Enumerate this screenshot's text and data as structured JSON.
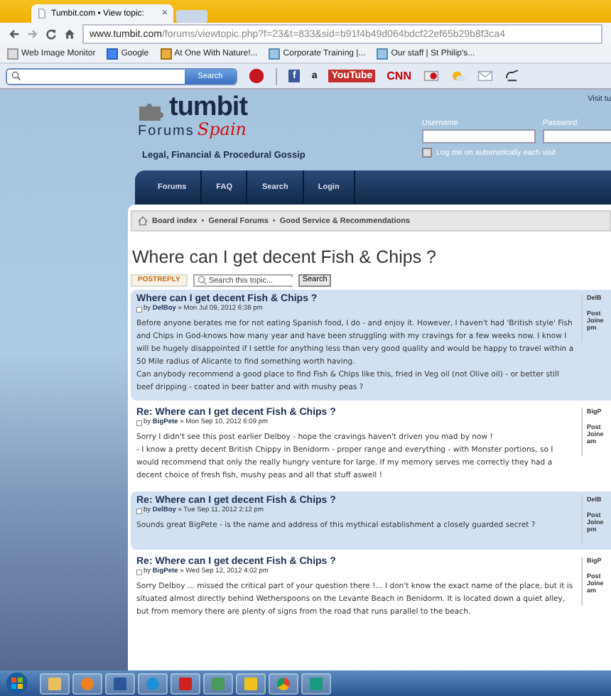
{
  "browser": {
    "tab_title": "Tumbit.com • View topic:",
    "tab_close": "×",
    "url_host": "www.tumbit.com",
    "url_path": "/forums/viewtopic.php?f=23&t=833&sid=b91f4b49d064bdcf22ef65b29b8f3ca4",
    "bookmarks": [
      "Web Image Monitor",
      "Google",
      "At One With Nature!...",
      "Corporate Training |...",
      "Our staff | St Philip's..."
    ],
    "search_button": "Search",
    "toolbar_items": [
      {
        "kind": "facebook",
        "label": "f"
      },
      {
        "kind": "amazon",
        "label": "a"
      },
      {
        "kind": "youtube",
        "label": "YouTube"
      },
      {
        "kind": "cnn",
        "label": "CNN"
      }
    ]
  },
  "site": {
    "logo_main": "tumbit",
    "logo_sub": "Forums",
    "logo_script": "Spain",
    "tagline": "Legal, Financial & Procedural Gossip",
    "visit_link": "Visit tu",
    "login": {
      "username_label": "Username",
      "password_label": "Password",
      "remember_label": "Log me on automatically each visit",
      "remember_checked": false
    },
    "nav": [
      "Forums",
      "FAQ",
      "Search",
      "Login"
    ],
    "breadcrumb": {
      "items": [
        "Board index",
        "General Forums",
        "Good Service & Recommendations"
      ],
      "separator": "•"
    }
  },
  "topic": {
    "title": "Where can I get decent Fish & Chips ?",
    "post_reply": "POSTREPLY",
    "search_placeholder": "Search this topic...",
    "search_button": "Search",
    "posts": [
      {
        "shaded": true,
        "subject": "Where can I get decent Fish & Chips ?",
        "byline": "by **DelBoy** » Mon Jul 09, 2012 6:38 pm",
        "body": [
          "Before anyone berates me for not eating Spanish food, I do - and enjoy it. However, I haven't had 'British style' Fish and Chips in God-knows how many year and have been struggling with my cravings for a few weeks now. I know I will be hugely disappointed if I settle for anything less than very good quality and would be happy to travel within a 50 Mile radius of Alicante to find something worth having.",
          "Can anybody recommend a good place to find Fish & Chips like this, fried in Veg oil (not Olive oil) - or better still beef dripping - coated in beer batter and with mushy peas ?"
        ],
        "profile": [
          "DelB",
          "Post",
          "Joine",
          "pm"
        ]
      },
      {
        "shaded": false,
        "subject": "Re: Where can I get decent Fish & Chips ?",
        "byline": "by **BigPete** » Mon Sep 10, 2012 6:09 pm",
        "body": [
          "Sorry I didn't see this post earlier Delboy - hope the cravings haven't driven you mad by now !",
          "- I know a pretty decent British Chippy in Benidorm - proper range and everything - with Monster portions, so I would recommend that only the really hungry venture for large. If my memory serves me correctly they had a decent choice of fresh fish, mushy peas and all that stuff aswell !"
        ],
        "profile": [
          "BigP",
          "Post",
          "Joine",
          "am"
        ]
      },
      {
        "shaded": true,
        "subject": "Re: Where can I get decent Fish & Chips ?",
        "byline": "by **DelBoy** » Tue Sep 11, 2012 2:12 pm",
        "body": [
          "Sounds great BigPete - is the name and address of this mythical establishment a closely guarded secret ?"
        ],
        "profile": [
          "DelB",
          "Post",
          "Joine",
          "pm"
        ]
      },
      {
        "shaded": false,
        "subject": "Re: Where can I get decent Fish & Chips ?",
        "byline": "by **BigPete** » Wed Sep 12, 2012 4:02 pm",
        "body": [
          "Sorry Delboy ... missed the critical part of your question there !... I don't know the exact name of the place, but it is situated almost directly behind Wetherspoons on the Levante Beach in Benidorm. It is located down a quiet alley, but from memory there are plenty of signs from the road that runs parallel to the beach."
        ],
        "profile": [
          "BigP",
          "Post",
          "Joine",
          "am"
        ]
      }
    ]
  }
}
